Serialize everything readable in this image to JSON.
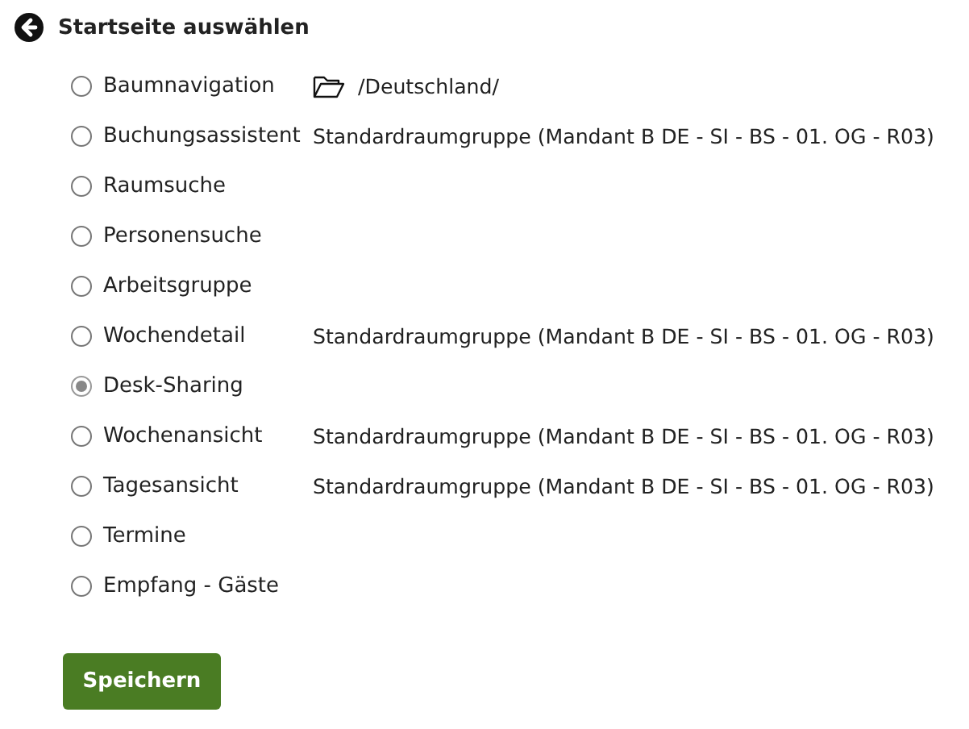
{
  "header": {
    "title": "Startseite auswählen"
  },
  "options": [
    {
      "label": "Baumnavigation",
      "selected": false,
      "detail": {
        "kind": "path",
        "text": "/Deutschland/"
      }
    },
    {
      "label": "Buchungsassistent",
      "selected": false,
      "detail": {
        "kind": "text",
        "text": "Standardraumgruppe (Mandant B DE - SI - BS - 01. OG - R03)"
      }
    },
    {
      "label": "Raumsuche",
      "selected": false
    },
    {
      "label": "Personensuche",
      "selected": false
    },
    {
      "label": "Arbeitsgruppe",
      "selected": false
    },
    {
      "label": "Wochendetail",
      "selected": false,
      "detail": {
        "kind": "text",
        "text": "Standardraumgruppe (Mandant B DE - SI - BS - 01. OG - R03)"
      }
    },
    {
      "label": "Desk-Sharing",
      "selected": true
    },
    {
      "label": "Wochenansicht",
      "selected": false,
      "detail": {
        "kind": "text",
        "text": "Standardraumgruppe (Mandant B DE - SI - BS - 01. OG - R03)"
      }
    },
    {
      "label": "Tagesansicht",
      "selected": false,
      "detail": {
        "kind": "text",
        "text": "Standardraumgruppe (Mandant B DE - SI - BS - 01. OG - R03)"
      }
    },
    {
      "label": "Termine",
      "selected": false
    },
    {
      "label": "Empfang - Gäste",
      "selected": false
    }
  ],
  "save_button": {
    "label": "Speichern"
  }
}
